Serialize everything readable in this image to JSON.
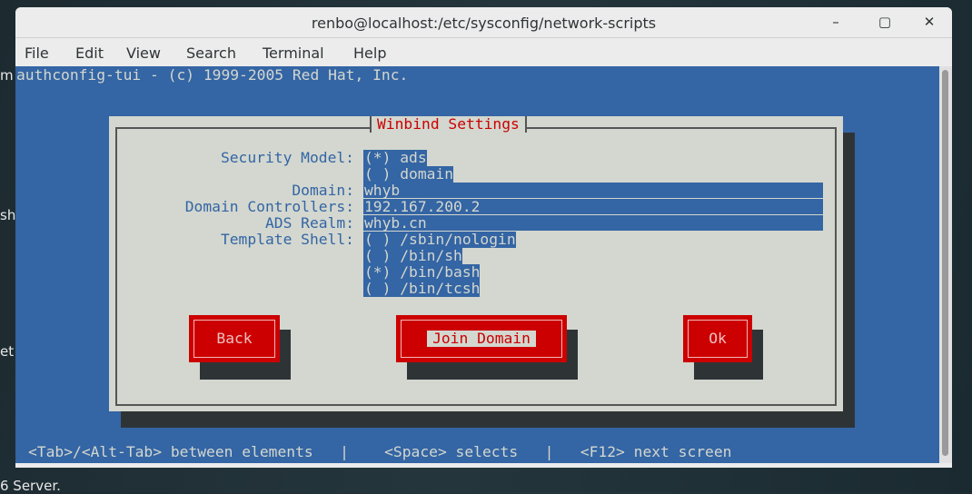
{
  "desktop": {
    "fragments": [
      "m",
      "sh",
      "et"
    ],
    "bottom_text": "6 Server."
  },
  "window": {
    "title": "renbo@localhost:/etc/sysconfig/network-scripts",
    "minimize": "–",
    "maximize": "▢",
    "close": "✕"
  },
  "menu": [
    "File",
    "Edit",
    "View",
    "Search",
    "Terminal",
    "Help"
  ],
  "terminal": {
    "header": "authconfig-tui - (c) 1999-2005 Red Hat, Inc.",
    "dialog": {
      "title": "Winbind Settings",
      "security_model": {
        "label": "Security Model:",
        "options": [
          "(*) ads",
          "( ) domain"
        ],
        "selected": "ads"
      },
      "domain": {
        "label": "Domain:",
        "value": "whyb"
      },
      "domain_controllers": {
        "label": "Domain Controllers:",
        "value": "192.167.200.2"
      },
      "ads_realm": {
        "label": "ADS Realm:",
        "value": "whyb.cn"
      },
      "template_shell": {
        "label": "Template Shell:",
        "options": [
          "( ) /sbin/nologin",
          "( ) /bin/sh",
          "(*) /bin/bash",
          "( ) /bin/tcsh"
        ],
        "selected": "/bin/bash"
      },
      "buttons": {
        "back": "Back",
        "join": "Join Domain",
        "ok": "Ok"
      }
    },
    "status": [
      "<Tab>/<Alt-Tab> between elements",
      "|",
      "<Space> selects",
      "|",
      "<F12> next screen"
    ]
  },
  "colors": {
    "terminal_bg": "#3465a4",
    "dialog_bg": "#d3d7cf",
    "accent_red": "#cc0000"
  }
}
